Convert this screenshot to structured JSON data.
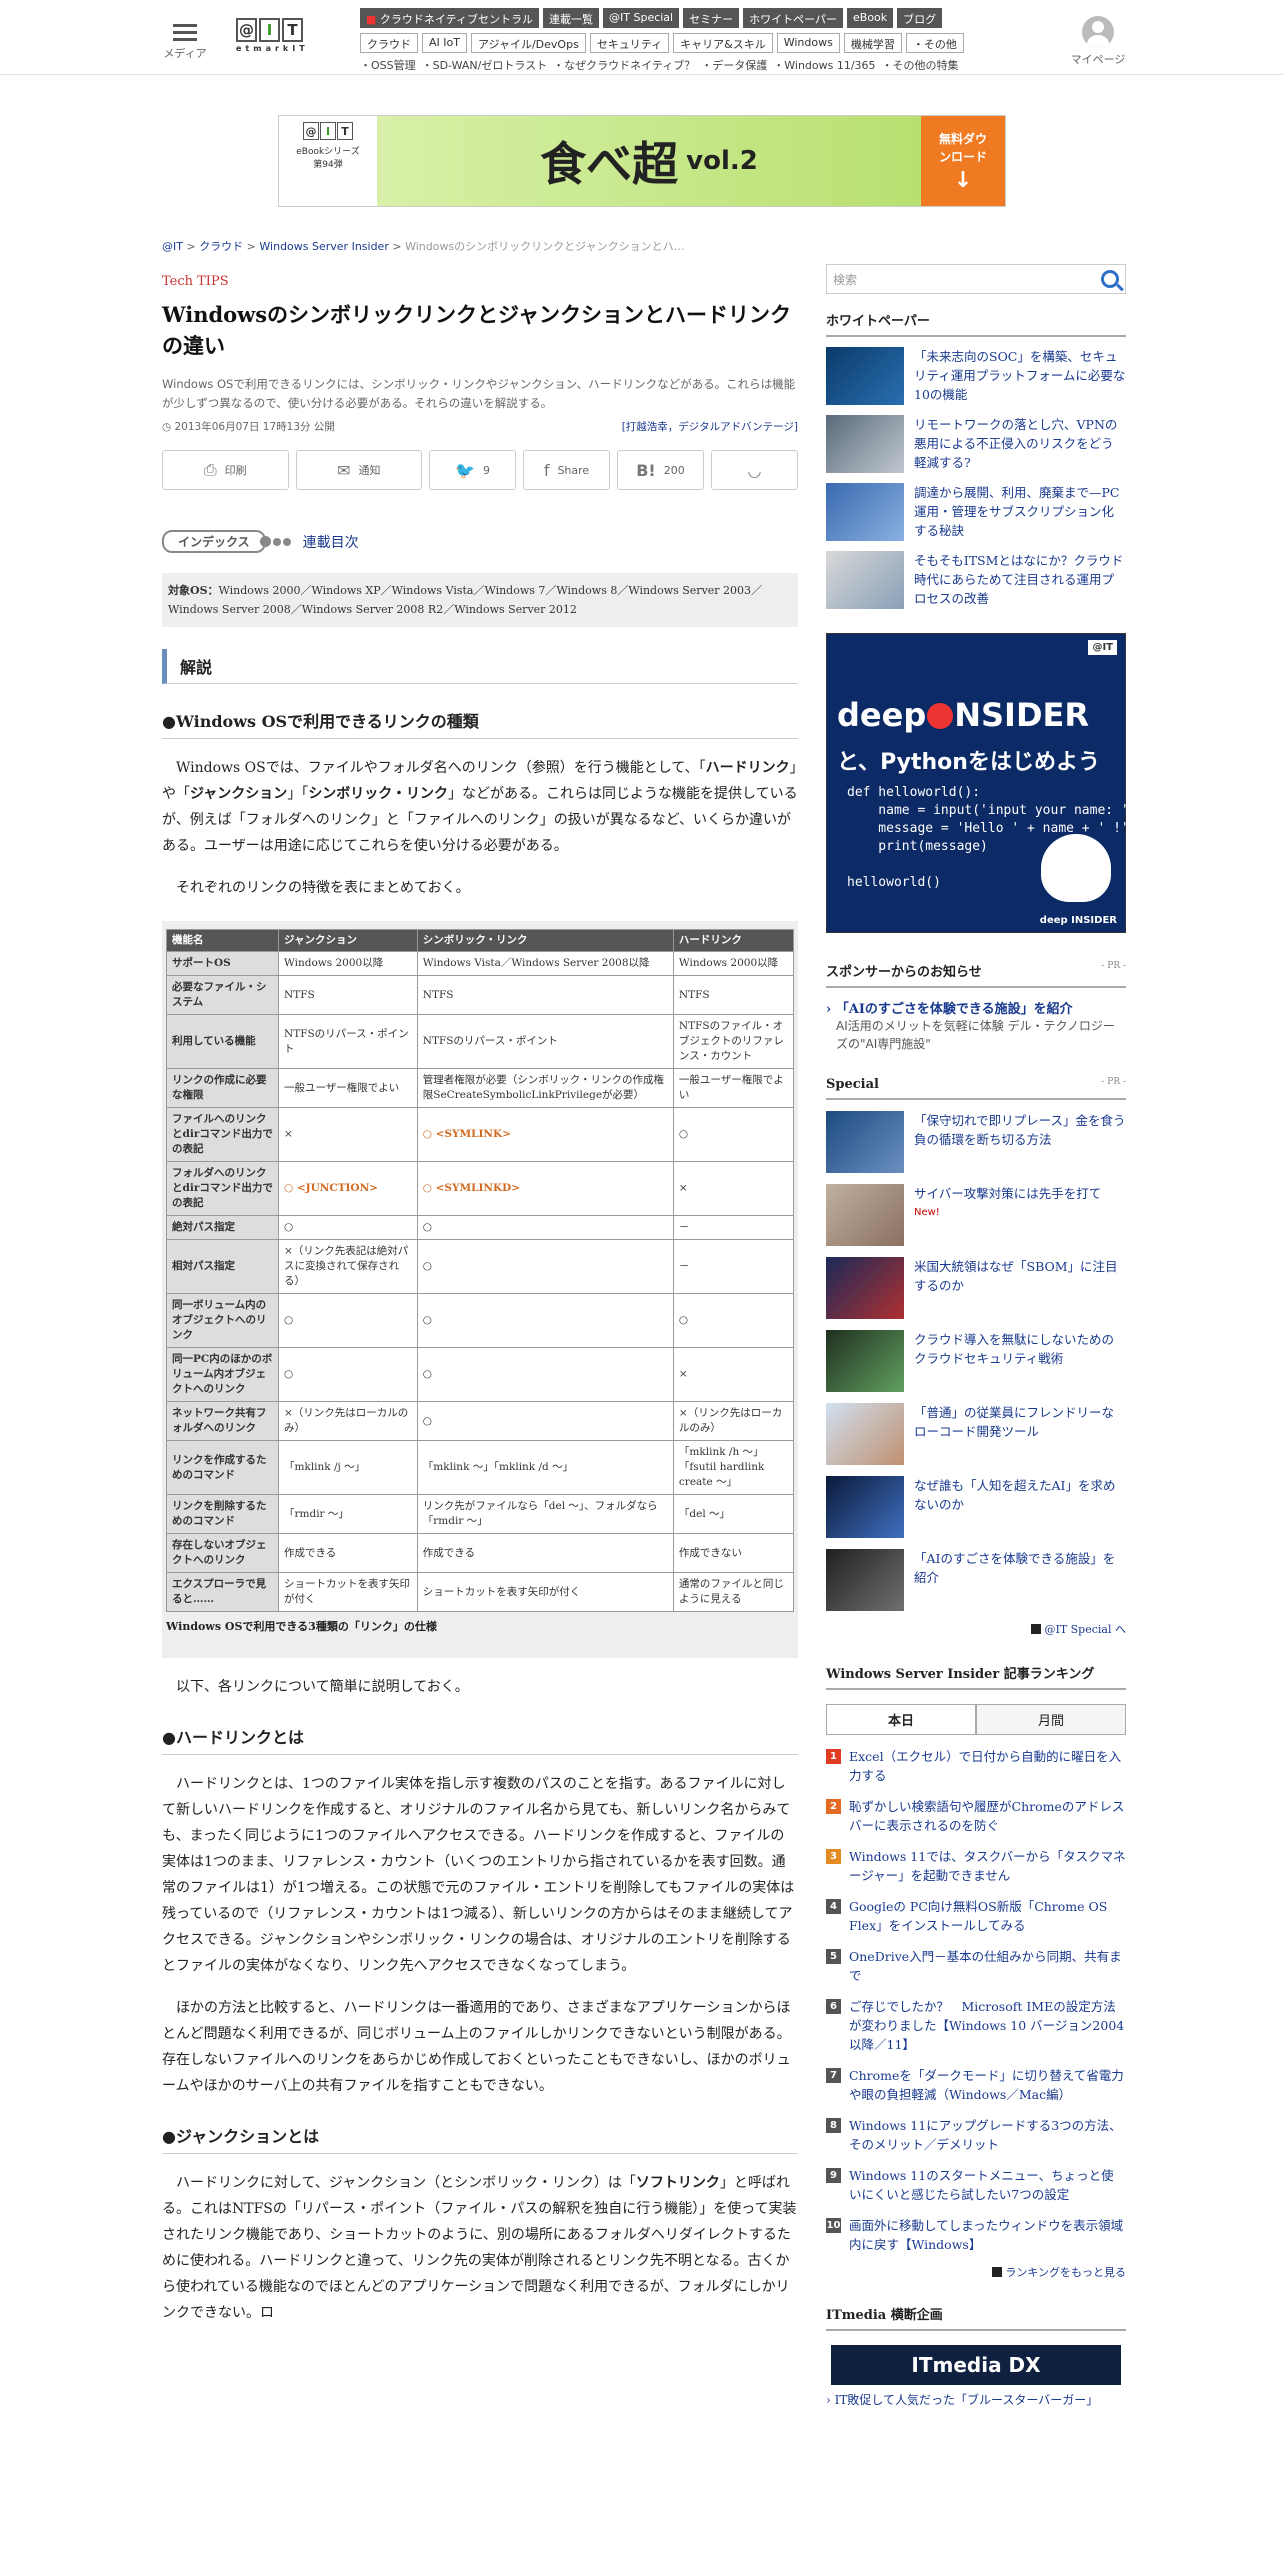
{
  "header": {
    "menu_label": "メディア",
    "mypage_label": "マイページ",
    "logo_sub": "etmarkIT",
    "nav_primary": [
      "クラウドネイティブセントラル",
      "連載一覧",
      "@IT Special",
      "セミナー",
      "ホワイトペーパー",
      "eBook",
      "ブログ"
    ],
    "nav_secondary": [
      "クラウド",
      "AI IoT",
      "アジャイル/DevOps",
      "セキュリティ",
      "キャリア&スキル",
      "Windows",
      "機械学習",
      "・その他"
    ],
    "nav_topics": [
      "・OSS管理",
      "・SD-WAN/ゼロトラスト",
      "・なぜクラウドネイティブ？",
      "・データ保護",
      "・Windows 11/365",
      "・その他の特集"
    ]
  },
  "banner": {
    "series": "eBookシリーズ",
    "issue": "第94弾",
    "title": "食べ超",
    "vol": "vol.2",
    "cta": "無料ダウンロード"
  },
  "breadcrumb": [
    "@IT",
    "クラウド",
    "Windows Server Insider",
    "Windowsのシンボリックリンクとジャンクションとハ…"
  ],
  "article": {
    "category": "Tech TIPS",
    "title": "Windowsのシンボリックリンクとジャンクションとハードリンクの違い",
    "lead": "Windows OSで利用できるリンクには、シンボリック・リンクやジャンクション、ハードリンクなどがある。これらは機能が少しずつ異なるので、使い分ける必要がある。それらの違いを解説する。",
    "date": "2013年06月07日 17時13分 公開",
    "author": "[打越浩幸，デジタルアドバンテージ]",
    "share": {
      "print": "印刷",
      "mail": "通知",
      "twitter_count": "9",
      "facebook": "Share",
      "hatena_count": "200"
    },
    "index_label": "インデックス",
    "index_link": "連載目次",
    "os_label": "対象OS：",
    "os_text": "Windows 2000／Windows XP／Windows Vista／Windows 7／Windows 8／Windows Server 2003／Windows Server 2008／Windows Server 2008 R2／Windows Server 2012",
    "section": "解説",
    "h_types": "●Windows OSで利用できるリンクの種類",
    "p1_a": "Windows OSでは、ファイルやフォルダ名へのリンク（参照）を行う機能として、「",
    "p1_b1": "ハードリンク",
    "p1_c": "」や「",
    "p1_b2": "ジャンクション",
    "p1_d": "」「",
    "p1_b3": "シンボリック・リンク",
    "p1_e": "」などがある。これらは同じような機能を提供しているが、例えば「フォルダへのリンク」と「ファイルへのリンク」の扱いが異なるなど、いくらか違いがある。ユーザーは用途に応じてこれらを使い分ける必要がある。",
    "p2": "それぞれのリンクの特徴を表にまとめておく。",
    "p3": "以下、各リンクについて簡単に説明しておく。",
    "h_hard": "●ハードリンクとは",
    "p4": "ハードリンクとは、1つのファイル実体を指し示す複数のパスのことを指す。あるファイルに対して新しいハードリンクを作成すると、オリジナルのファイル名から見ても、新しいリンク名からみても、まったく同じように1つのファイルへアクセスできる。ハードリンクを作成すると、ファイルの実体は1つのまま、リファレンス・カウント（いくつのエントリから指されているかを表す回数。通常のファイルは1）が1つ増える。この状態で元のファイル・エントリを削除してもファイルの実体は残っているので（リファレンス・カウントは1つ減る）、新しいリンクの方からはそのまま継続してアクセスできる。ジャンクションやシンボリック・リンクの場合は、オリジナルのエントリを削除するとファイルの実体がなくなり、リンク先へアクセスできなくなってしまう。",
    "p5": "ほかの方法と比較すると、ハードリンクは一番適用的であり、さまざまなアプリケーションからほとんど問題なく利用できるが、同じボリューム上のファイルしかリンクできないという制限がある。存在しないファイルへのリンクをあらかじめ作成しておくといったこともできないし、ほかのボリュームやほかのサーバ上の共有ファイルを指すこともできない。",
    "h_junction": "●ジャンクションとは",
    "p6_a": "ハードリンクに対して、ジャンクション（とシンボリック・リンク）は「",
    "p6_b": "ソフトリンク",
    "p6_c": "」と呼ばれる。これはNTFSの「リパース・ポイント（ファイル・パスの解釈を独自に行う機能）」を使って実装されたリンク機能であり、ショートカットのように、別の場所にあるフォルダへリダイレクトするために使われる。ハードリンクと違って、リンク先の実体が削除されるとリンク先不明となる。古くから使われている機能なのでほとんどのアプリケーションで問題なく利用できるが、フォルダにしかリンクできない。ロ"
  },
  "table": {
    "headers": [
      "機能名",
      "ジャンクション",
      "シンボリック・リンク",
      "ハードリンク"
    ],
    "rows": [
      [
        "サポートOS",
        "Windows 2000以降",
        "Windows Vista／Windows Server 2008以降",
        "Windows 2000以降"
      ],
      [
        "必要なファイル・システム",
        "NTFS",
        "NTFS",
        "NTFS"
      ],
      [
        "利用している機能",
        "NTFSのリパース・ポイント",
        "NTFSのリパース・ポイント",
        "NTFSのファイル・オブジェクトのリファレンス・カウント"
      ],
      [
        "リンクの作成に必要な権限",
        "一般ユーザー権限でよい",
        "管理者権限が必要（シンボリック・リンクの作成権限SeCreateSymbolicLinkPrivilegeが必要）",
        "一般ユーザー権限でよい"
      ],
      [
        "ファイルへのリンクとdirコマンド出力での表記",
        "×",
        "○ <SYMLINK>",
        "○"
      ],
      [
        "フォルダへのリンクとdirコマンド出力での表記",
        "○ <JUNCTION>",
        "○ <SYMLINKD>",
        "×"
      ],
      [
        "絶対パス指定",
        "○",
        "○",
        "－"
      ],
      [
        "相対パス指定",
        "×（リンク先表記は絶対パスに変換されて保存される）",
        "○",
        "－"
      ],
      [
        "同一ボリューム内のオブジェクトへのリンク",
        "○",
        "○",
        "○"
      ],
      [
        "同一PC内のほかのボリューム内オブジェクトへのリンク",
        "○",
        "○",
        "×"
      ],
      [
        "ネットワーク共有フォルダへのリンク",
        "×（リンク先はローカルのみ）",
        "○",
        "×（リンク先はローカルのみ）"
      ],
      [
        "リンクを作成するためのコマンド",
        "「mklink /j ～」",
        "「mklink ～」「mklink /d ～」",
        "「mklink /h ～」「fsutil hardlink create ～」"
      ],
      [
        "リンクを削除するためのコマンド",
        "「rmdir ～」",
        "リンク先がファイルなら「del ～」、フォルダなら「rmdir ～」",
        "「del ～」"
      ],
      [
        "存在しないオブジェクトへのリンク",
        "作成できる",
        "作成できる",
        "作成できない"
      ],
      [
        "エクスプローラで見ると……",
        "ショートカットを表す矢印が付く",
        "ショートカットを表す矢印が付く",
        "通常のファイルと同じように見える"
      ]
    ],
    "caption": "Windows OSで利用できる3種類の「リンク」の仕様"
  },
  "sidebar": {
    "search_placeholder": "検索",
    "whitepaper_head": "ホワイトペーパー",
    "whitepapers": [
      "「未来志向のSOC」を構築、セキュリティ運用プラットフォームに必要な10の機能",
      "リモートワークの落とし穴、VPNの悪用による不正侵入のリスクをどう軽減する?",
      "調達から展開、利用、廃棄まで—PC運用・管理をサブスクリプション化する秘訣",
      "そもそもITSMとはなにか？クラウド時代にあらためて注目される運用プロセスの改善"
    ],
    "ad": {
      "brand_a": "deep",
      "brand_b": "NSIDER",
      "subtitle": "と、Pythonをはじめよう",
      "code": [
        "def helloworld():",
        "    name = input('input your name: ')",
        "    message = 'Hello ' + name + ' !'",
        "    print(message)",
        "",
        "helloworld()"
      ],
      "footer": "deep INSIDER"
    },
    "sponsor_head": "スポンサーからのお知らせ",
    "pr": "- PR -",
    "sponsor_title": "「AIのすごさを体験できる施設」を紹介",
    "sponsor_body": "AI活用のメリットを気軽に体験 デル・テクノロジーズの\"AI専門施設\"",
    "special_head": "Special",
    "specials": [
      "「保守切れで即リプレース」金を食う負の循環を断ち切る方法",
      "サイバー攻撃対策には先手を打て",
      "米国大統領はなぜ「SBOM」に注目するのか",
      "クラウド導入を無駄にしないためのクラウドセキュリティ戦術",
      "「普通」の従業員にフレンドリーなローコード開発ツール",
      "なぜ誰も「人知を超えたAI」を求めないのか",
      "「AIのすごさを体験できる施設」を紹介"
    ],
    "new_label": "New!",
    "special_more": "@IT Special へ",
    "ranking_head": "Windows Server Insider 記事ランキング",
    "tab_today": "本日",
    "tab_month": "月間",
    "ranking": [
      "Excel（エクセル）で日付から自動的に曜日を入力する",
      "恥ずかしい検索語句や履歴がChromeのアドレスバーに表示されるのを防ぐ",
      "Windows 11では、タスクバーから「タスクマネージャー」を起動できません",
      "Googleの PC向け無料OS新版「Chrome OS Flex」をインストールしてみる",
      "OneDrive入門－基本の仕組みから同期、共有まで",
      "ご存じでしたか？　Microsoft IMEの設定方法が変わりました【Windows 10 バージョン2004以降／11】",
      "Chromeを「ダークモード」に切り替えて省電力や眼の負担軽減（Windows／Mac編）",
      "Windows 11にアップグレードする3つの方法、そのメリット／デメリット",
      "Windows 11のスタートメニュー、ちょっと使いにくいと感じたら試したい7つの設定",
      "画面外に移動してしまったウィンドウを表示領域内に戻す【Windows】"
    ],
    "ranking_more": "ランキングをもっと見る",
    "itm_head": "ITmedia 横断企画",
    "itm_ad": "ITmedia DX",
    "itm_link": "IT敗促して人気だった「ブルースターバーガー」"
  },
  "colors": {
    "accent": "#1a3a8f",
    "category": "#cc3333",
    "orange": "#d2691e",
    "rank": [
      "#e33a22",
      "#e36a22",
      "#e38a22",
      "#555555",
      "#555555",
      "#555555",
      "#555555",
      "#555555",
      "#555555",
      "#555555"
    ]
  }
}
